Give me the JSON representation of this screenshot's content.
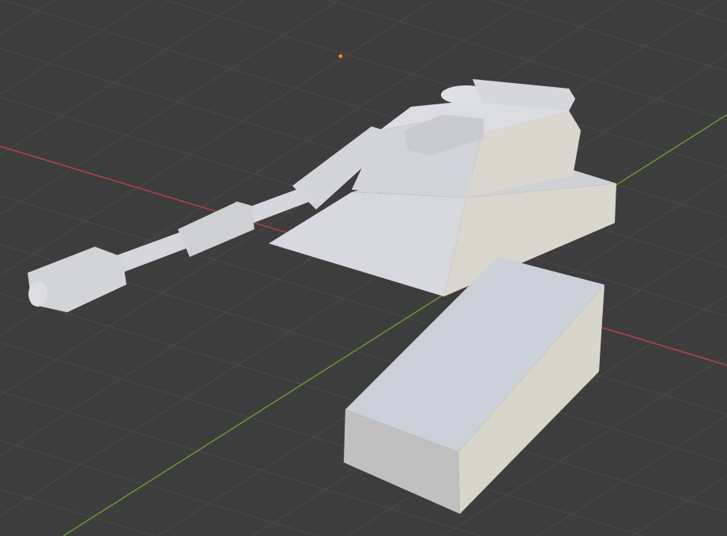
{
  "viewport": {
    "background_color": "#3d3d3d",
    "grid_color": "#4b4b4b",
    "x_axis_color": "#b5414a",
    "y_axis_color": "#6a9a2c",
    "origin_color": "#f08a24"
  },
  "model": {
    "light_face": "#d4d6dc",
    "mid_face": "#c9cacd",
    "warm_face": "#d9d6cc",
    "dark_face": "#bdbdbd"
  },
  "icons": [
    "object-origin-icon"
  ]
}
